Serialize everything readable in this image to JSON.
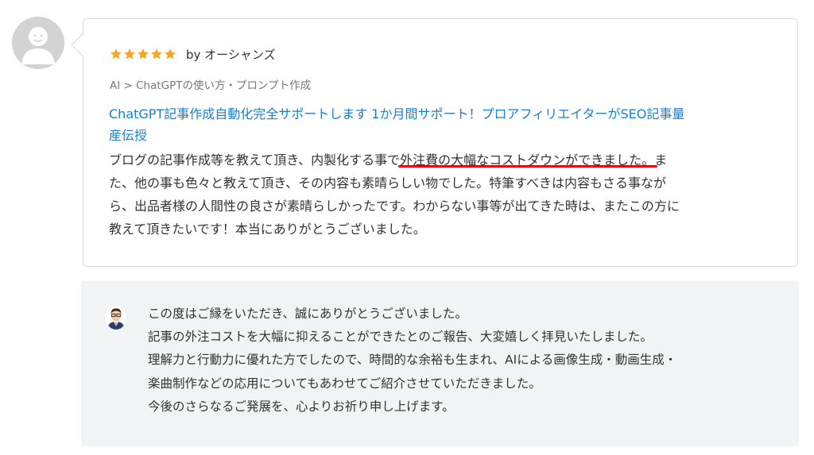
{
  "review": {
    "rating": 5,
    "author": "by オーシャンズ",
    "breadcrumb": "AI > ChatGPTの使い方・プロンプト作成",
    "service_title": "ChatGPT記事作成自動化完全サポートします 1か月間サポート！プロアフィリエイターがSEO記事量\n産伝授",
    "body": {
      "line1_before": "ブログの記事作成等を教えて頂き、内製化する事で",
      "line1_highlight": "外注費の大幅なコストダウンができました。",
      "line1_after": "ま",
      "line2": "た、他の事も色々と教えて頂き、その内容も素晴らしい物でした。特筆すべきは内容もさる事なが",
      "line3": "ら、出品者様の人間性の良さが素晴らしかったです。わからない事等が出てきた時は、またこの方に",
      "line4": "教えて頂きたいです！本当にありがとうございました。"
    }
  },
  "reply": {
    "lines": [
      "この度はご縁をいただき、誠にありがとうございました。",
      "記事の外注コストを大幅に抑えることができたとのご報告、大変嬉しく拝見いたしました。",
      "理解力と行動力に優れた方でしたので、時間的な余裕も生まれ、AIによる画像生成・動画生成・",
      "楽曲制作などの応用についてもあわせてご紹介させていただきました。",
      "今後のさらなるご発展を、心よりお祈り申し上げます。"
    ]
  },
  "colors": {
    "star": "#f5a623",
    "link": "#1a7fd0",
    "underline": "#e8001c",
    "reply_bg": "#f2f3f5"
  },
  "icons": {
    "avatar": "user-silhouette-icon",
    "star": "star-icon",
    "seller": "seller-avatar-icon"
  }
}
